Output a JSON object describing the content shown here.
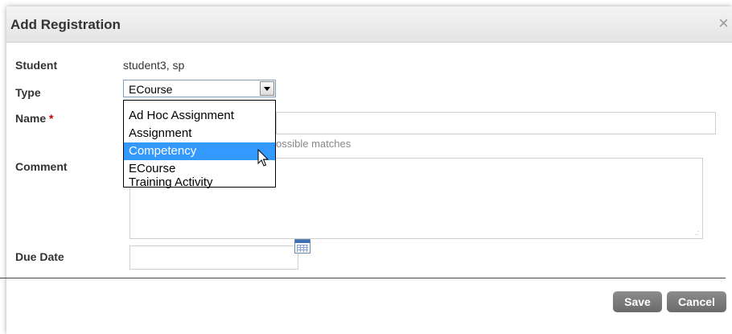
{
  "dialog": {
    "title": "Add Registration",
    "close_glyph": "×"
  },
  "form": {
    "student_label": "Student",
    "student_value": "student3, sp",
    "type_label": "Type",
    "type_selected": "ECourse",
    "name_label": "Name",
    "name_required": "*",
    "name_hint": "ossible matches",
    "comment_label": "Comment",
    "due_date_label": "Due Date"
  },
  "type_options": [
    "Ad Hoc Assignment",
    "Assignment",
    "Competency",
    "ECourse",
    "Training Activity"
  ],
  "type_highlighted": "Competency",
  "buttons": {
    "save": "Save",
    "cancel": "Cancel"
  },
  "icons": {
    "close": "close-icon",
    "dropdown": "chevron-down-icon",
    "calendar": "calendar-icon",
    "cursor": "mouse-pointer-icon"
  },
  "colors": {
    "highlight": "#3399ff",
    "required": "#cc0000",
    "button": "#7a7a7a"
  }
}
